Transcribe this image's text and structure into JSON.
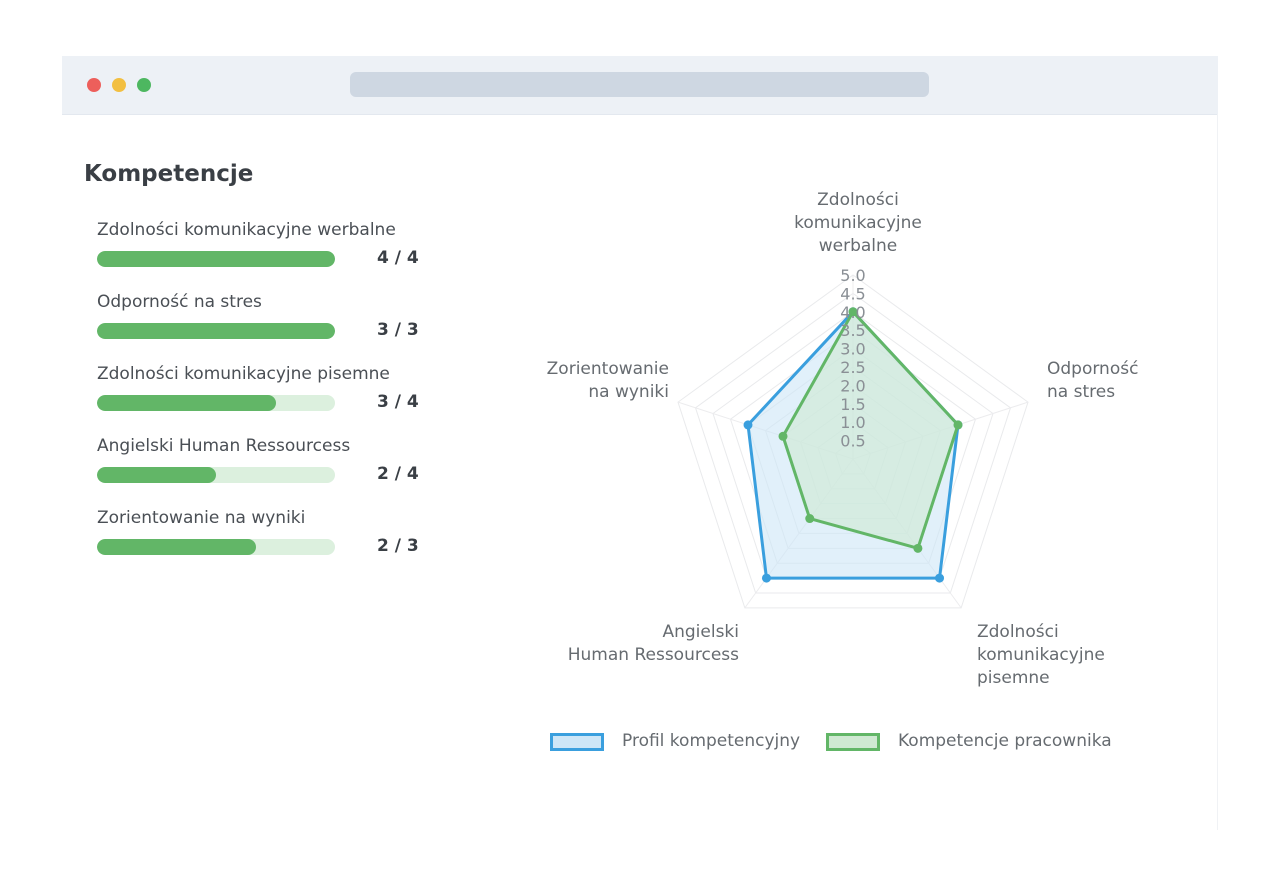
{
  "window": {
    "dots": [
      {
        "name": "close",
        "color": "#ed5f5b"
      },
      {
        "name": "minimize",
        "color": "#f2bf41"
      },
      {
        "name": "maximize",
        "color": "#4db760"
      }
    ]
  },
  "section_title": "Kompetencje",
  "competencies": [
    {
      "label": "Zdolności komunikacyjne werbalne",
      "score": "4 / 4",
      "value": 4,
      "max": 4
    },
    {
      "label": "Odporność na stres",
      "score": "3 / 3",
      "value": 3,
      "max": 3
    },
    {
      "label": "Zdolności komunikacyjne pisemne",
      "score": "3 / 4",
      "value": 3,
      "max": 4
    },
    {
      "label": "Angielski Human Ressourcess",
      "score": "2 / 4",
      "value": 2,
      "max": 4
    },
    {
      "label": "Zorientowanie na wyniki",
      "score": "2 / 3",
      "value": 2,
      "max": 3
    }
  ],
  "chart_data": {
    "type": "radar",
    "axes": [
      [
        "Zdolności",
        "komunikacyjne",
        "werbalne"
      ],
      [
        "Odporność",
        "na stres"
      ],
      [
        "Zdolności",
        "komunikacyjne",
        "pisemne"
      ],
      [
        "Angielski",
        "Human Ressourcess"
      ],
      [
        "Zorientowanie",
        "na wyniki"
      ]
    ],
    "r_range": [
      0,
      5
    ],
    "ticks": [
      "0.5",
      "1.0",
      "1.5",
      "2.0",
      "2.5",
      "3.0",
      "3.5",
      "4.0",
      "4.5",
      "5.0"
    ],
    "series": [
      {
        "name": "Profil kompetencyjny",
        "values": [
          4,
          3,
          4,
          4,
          3
        ],
        "stroke": "#3a9fde",
        "fill": "#cde6f7"
      },
      {
        "name": "Kompetencje pracownika",
        "values": [
          4,
          3,
          3,
          2,
          2
        ],
        "stroke": "#62b667",
        "fill": "#cfe9d2"
      }
    ]
  }
}
